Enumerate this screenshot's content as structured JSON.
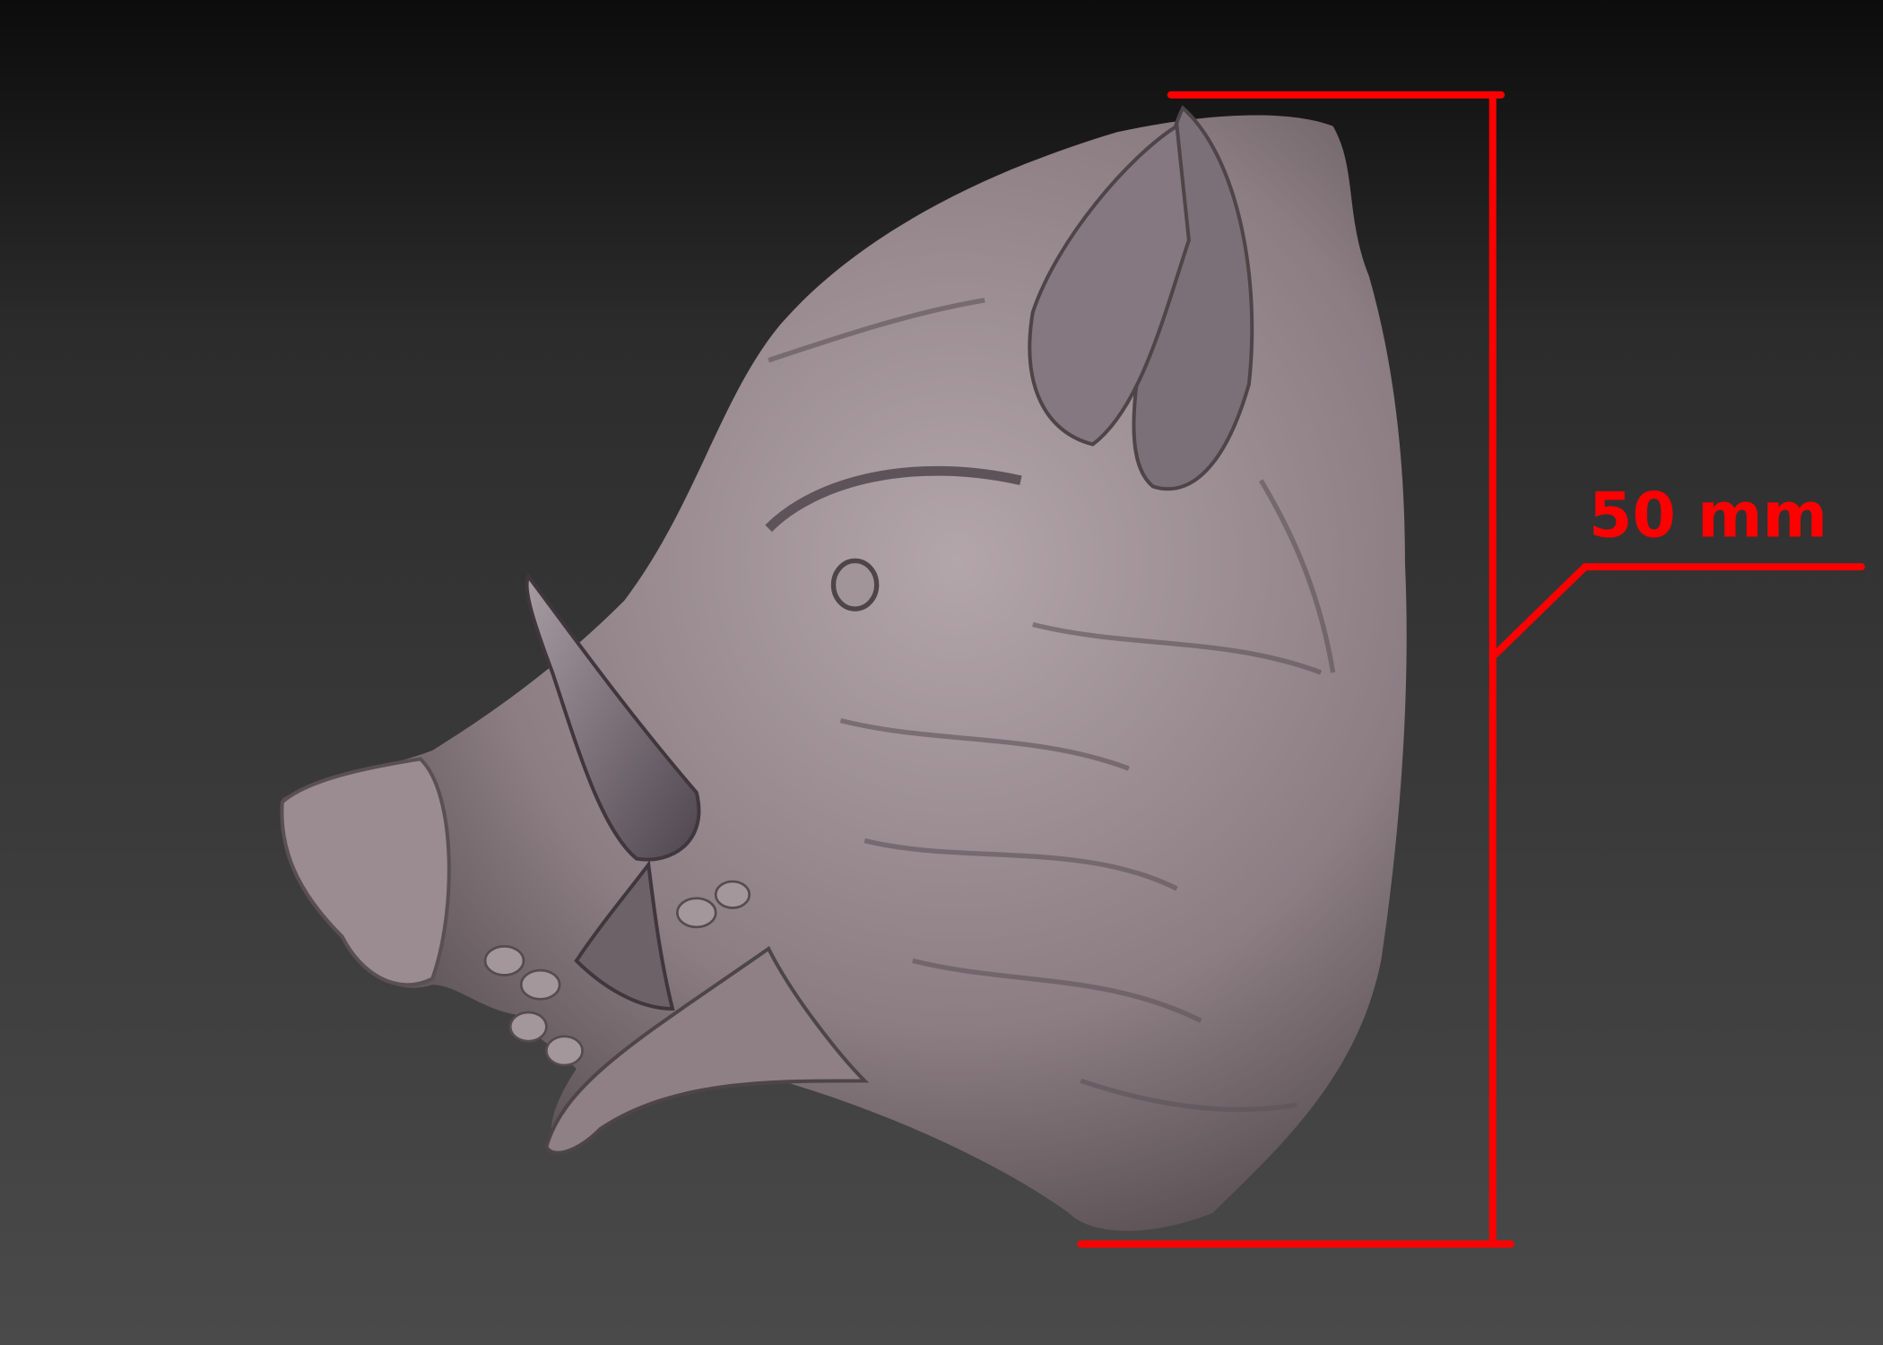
{
  "render": {
    "subject": "boar-head-sculpt",
    "colors": {
      "model": "#8b7d82",
      "model_shadow": "#4e4548",
      "model_highlight": "#b3a6aa",
      "annotation": "#ff0000"
    }
  },
  "dimension": {
    "label": "50 mm"
  }
}
